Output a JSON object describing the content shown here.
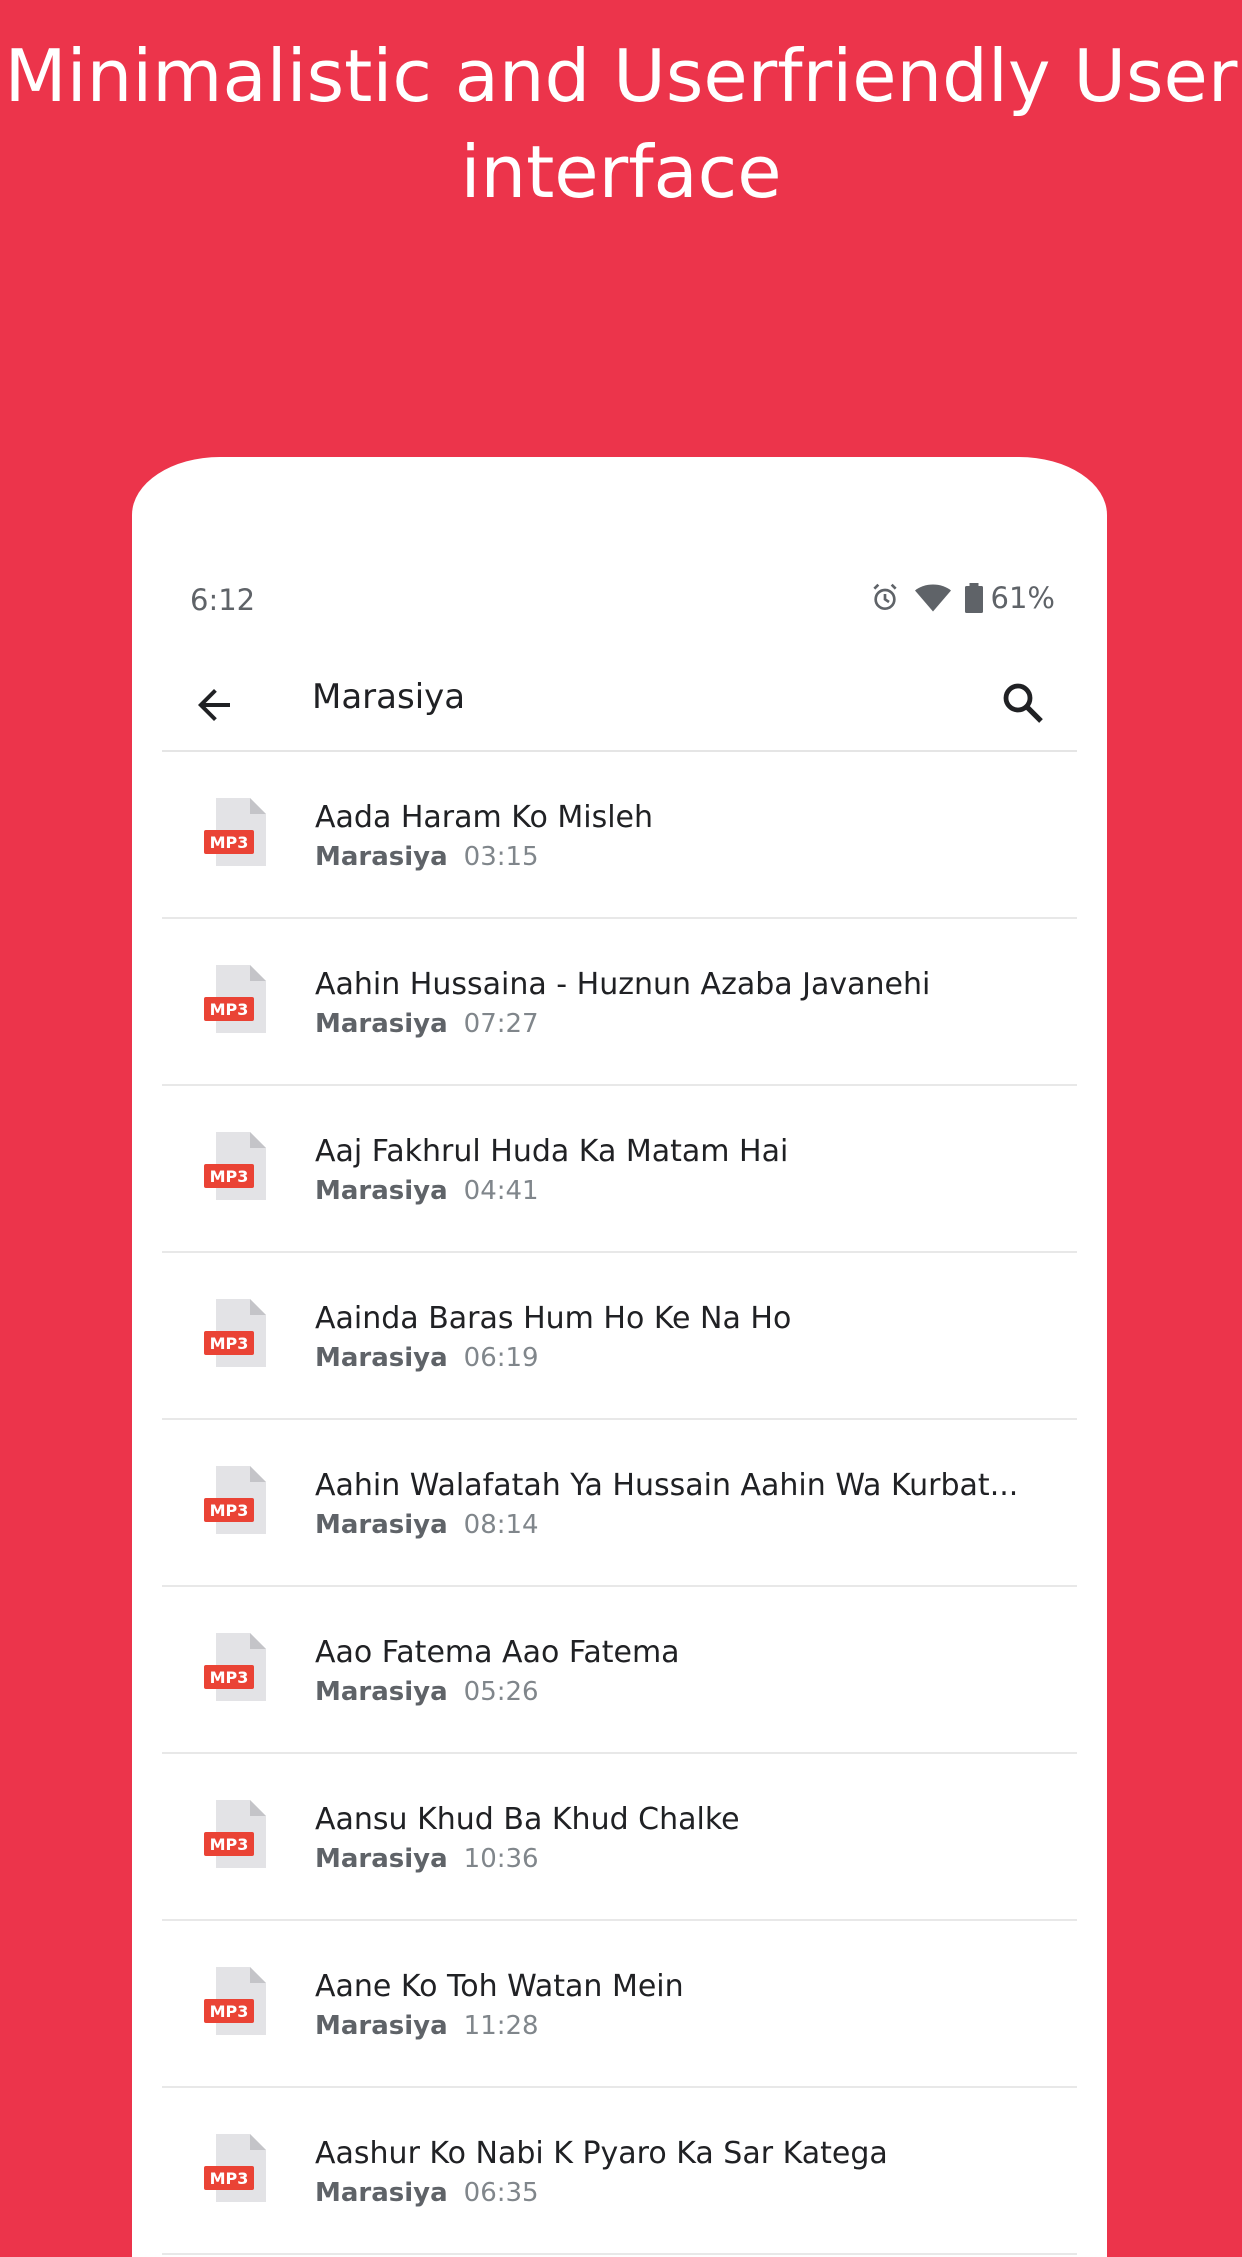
{
  "headline": "Minimalistic and Userfriendly User interface",
  "status_bar": {
    "time": "6:12",
    "battery": "61%",
    "icons": [
      "alarm-icon",
      "wifi-icon",
      "battery-icon"
    ]
  },
  "toolbar": {
    "title": "Marasiya",
    "back_icon": "arrow-back-icon",
    "search_icon": "search-icon"
  },
  "file_badge": "MP3",
  "tracks": [
    {
      "title": "Aada Haram Ko Misleh",
      "artist": "Marasiya",
      "duration": "03:15"
    },
    {
      "title": "Aahin Hussaina - Huznun Azaba Javanehi",
      "artist": "Marasiya",
      "duration": "07:27"
    },
    {
      "title": "Aaj Fakhrul Huda Ka Matam Hai",
      "artist": "Marasiya",
      "duration": "04:41"
    },
    {
      "title": "Aainda Baras Hum Ho Ke Na Ho",
      "artist": "Marasiya",
      "duration": "06:19"
    },
    {
      "title": "Aahin Walafatah Ya Hussain Aahin Wa Kurbat...",
      "artist": "Marasiya",
      "duration": "08:14"
    },
    {
      "title": "Aao Fatema Aao Fatema",
      "artist": "Marasiya",
      "duration": "05:26"
    },
    {
      "title": "Aansu Khud Ba Khud Chalke",
      "artist": "Marasiya",
      "duration": "10:36"
    },
    {
      "title": "Aane Ko Toh Watan Mein",
      "artist": "Marasiya",
      "duration": "11:28"
    },
    {
      "title": "Aashur Ko Nabi K Pyaro Ka Sar Katega",
      "artist": "Marasiya",
      "duration": "06:35"
    }
  ],
  "colors": {
    "background": "#EC344B",
    "badge": "#EA4335",
    "file_body": "#E3E3E6"
  }
}
